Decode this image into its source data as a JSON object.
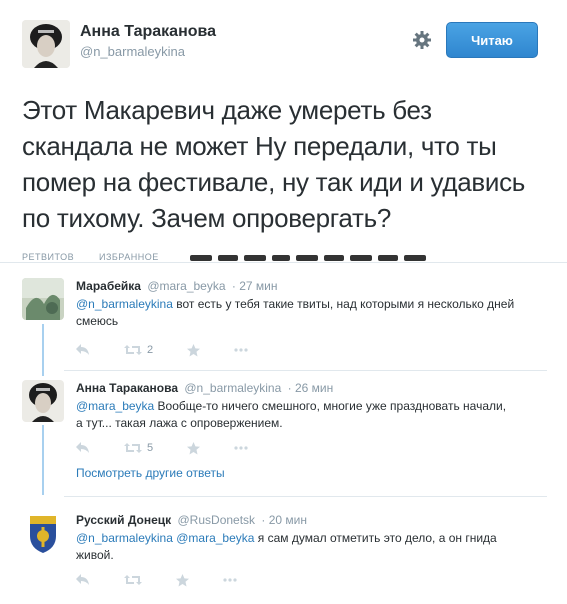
{
  "tweet": {
    "author_name": "Анна Тараканова",
    "author_handle": "@n_barmaleykina",
    "follow_label": "Читаю",
    "text": "Этот Макаревич даже умереть без скандала не может Ну передали, что ты помер на фестивале, ну так иди и удавись по тихому. Зачем опровергать?",
    "stats": {
      "retweets_label": "РЕТВИТОВ",
      "favorites_label": "ИЗБРАННОЕ"
    }
  },
  "replies": [
    {
      "name": "Марабейка",
      "handle": "@mara_beyka",
      "time": "· 27 мин",
      "mention": "@n_barmaleykina",
      "text": " вот есть у тебя такие твиты, над которыми я несколько дней смеюсь",
      "retweets": "2"
    },
    {
      "name": "Анна Тараканова",
      "handle": "@n_barmaleykina",
      "time": "· 26 мин",
      "mention": "@mara_beyka",
      "text": " Вообще-то ничего смешного, многие уже праздновать начали, а тут... такая лажа с опровержением.",
      "retweets": "5"
    },
    {
      "name": "Русский Донецк",
      "handle": "@RusDonetsk",
      "time": "· 20 мин",
      "mention": "@n_barmaleykina @mara_beyka",
      "text": " я сам думал отметить это дело, а он гнида живой.",
      "retweets": ""
    }
  ],
  "more_replies_label": "Посмотреть другие ответы",
  "icons": [
    "gear-icon",
    "reply-icon",
    "retweet-icon",
    "favorite-icon",
    "more-icon"
  ],
  "colors": {
    "link": "#2b7bb9",
    "button": "#3b94d9",
    "thread": "#a8d0ef"
  }
}
